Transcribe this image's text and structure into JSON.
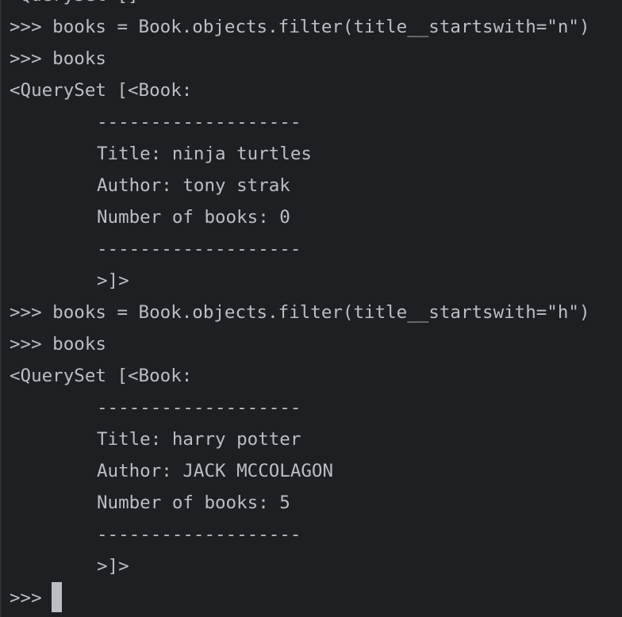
{
  "console": {
    "lines": [
      {
        "text": "<QuerySet []>",
        "indent": false
      },
      {
        "text": ">>> books = Book.objects.filter(title__startswith=\"n\")",
        "indent": false
      },
      {
        "text": ">>> books",
        "indent": false
      },
      {
        "text": "<QuerySet [<Book:",
        "indent": false
      },
      {
        "text": "-------------------",
        "indent": true
      },
      {
        "text": "Title: ninja turtles",
        "indent": true
      },
      {
        "text": "Author: tony strak",
        "indent": true
      },
      {
        "text": "Number of books: 0",
        "indent": true
      },
      {
        "text": "-------------------",
        "indent": true
      },
      {
        "text": ">]>",
        "indent": true
      },
      {
        "text": ">>> books = Book.objects.filter(title__startswith=\"h\")",
        "indent": false
      },
      {
        "text": ">>> books",
        "indent": false
      },
      {
        "text": "<QuerySet [<Book:",
        "indent": false
      },
      {
        "text": "-------------------",
        "indent": true
      },
      {
        "text": "Title: harry potter",
        "indent": true
      },
      {
        "text": "Author: JACK MCCOLAGON",
        "indent": true
      },
      {
        "text": "Number of books: 5",
        "indent": true
      },
      {
        "text": "-------------------",
        "indent": true
      },
      {
        "text": ">]>",
        "indent": true
      }
    ],
    "prompt": ">>>"
  }
}
